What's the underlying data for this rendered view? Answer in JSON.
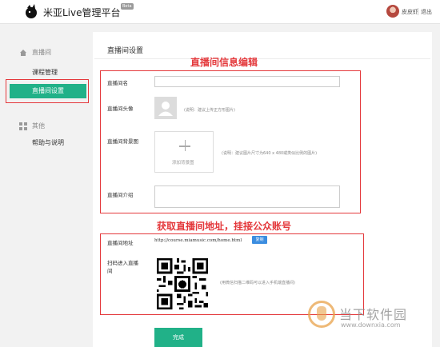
{
  "header": {
    "app_title": "米亚Live管理平台",
    "badge": "Beta",
    "username": "皮皮虾",
    "logout": "退出"
  },
  "sidebar": {
    "group1": "直播间",
    "items": [
      {
        "label": "课程管理",
        "active": false
      },
      {
        "label": "直播间设置",
        "active": true
      }
    ],
    "group2": "其他",
    "items2": [
      {
        "label": "帮助与说明"
      }
    ]
  },
  "main": {
    "page_title": "直播间设置",
    "annotation_top": "直播间信息编辑",
    "annotation_mid": "获取直播间地址，挂接公众账号",
    "form": {
      "name_label": "直播间名",
      "name_value": "",
      "avatar_label": "直播间头像",
      "avatar_hint": "(说明：建议上传正方形图片)",
      "bg_label": "直播间背景图",
      "bg_upload_text": "添加背景图",
      "bg_hint": "(说明：建议图片尺寸为640 x 480或类似比例的图片)",
      "intro_label": "直播间介绍",
      "intro_value": "",
      "address_label": "直播间地址",
      "address_value": "http://course.miamusic.com/home.html",
      "copy_button": "复制",
      "qr_label": "扫码进入直播间",
      "qr_hint": "(用微信扫描二维码可以进入手机端直播间)",
      "done_button": "完成"
    }
  },
  "watermark": {
    "text": "当下软件园",
    "url": "www.downxia.com"
  },
  "colors": {
    "accent": "#21b188",
    "annotation": "#e4393c",
    "copy": "#3b8de0"
  }
}
